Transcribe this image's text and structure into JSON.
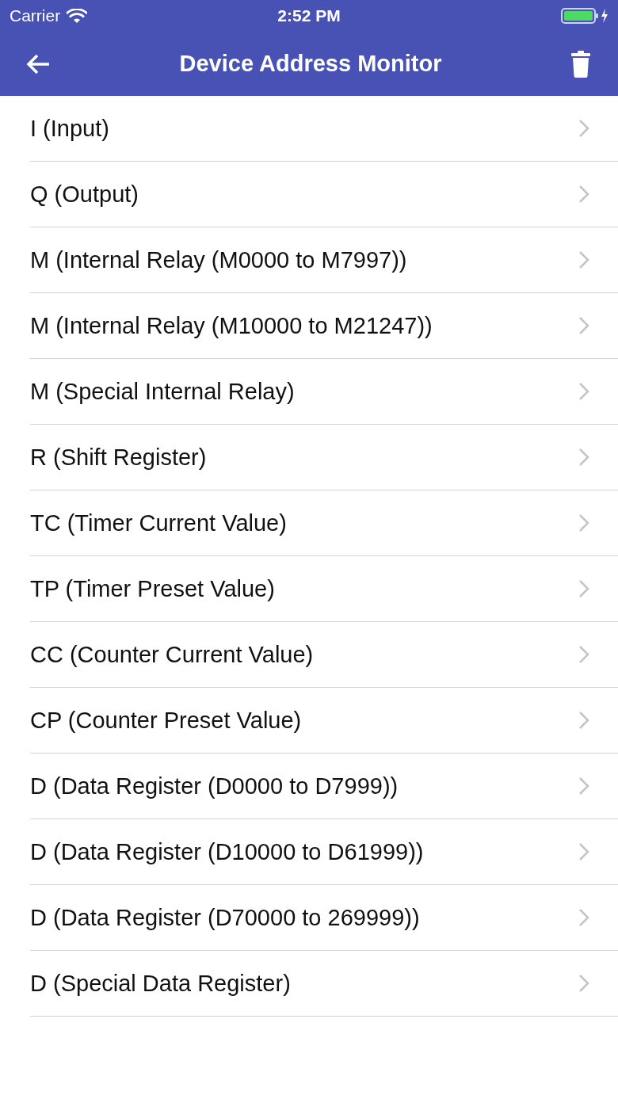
{
  "status_bar": {
    "carrier": "Carrier",
    "time": "2:52 PM"
  },
  "nav_bar": {
    "title": "Device Address Monitor"
  },
  "items": [
    {
      "label": "I (Input)"
    },
    {
      "label": "Q (Output)"
    },
    {
      "label": "M (Internal Relay (M0000 to M7997))"
    },
    {
      "label": "M (Internal Relay (M10000 to M21247))"
    },
    {
      "label": "M (Special Internal Relay)"
    },
    {
      "label": "R (Shift Register)"
    },
    {
      "label": "TC (Timer Current Value)"
    },
    {
      "label": "TP (Timer Preset Value)"
    },
    {
      "label": "CC (Counter Current Value)"
    },
    {
      "label": "CP (Counter Preset Value)"
    },
    {
      "label": "D (Data Register (D0000 to D7999))"
    },
    {
      "label": "D (Data Register (D10000 to D61999))"
    },
    {
      "label": "D (Data Register (D70000 to 269999))"
    },
    {
      "label": "D (Special Data Register)"
    }
  ]
}
